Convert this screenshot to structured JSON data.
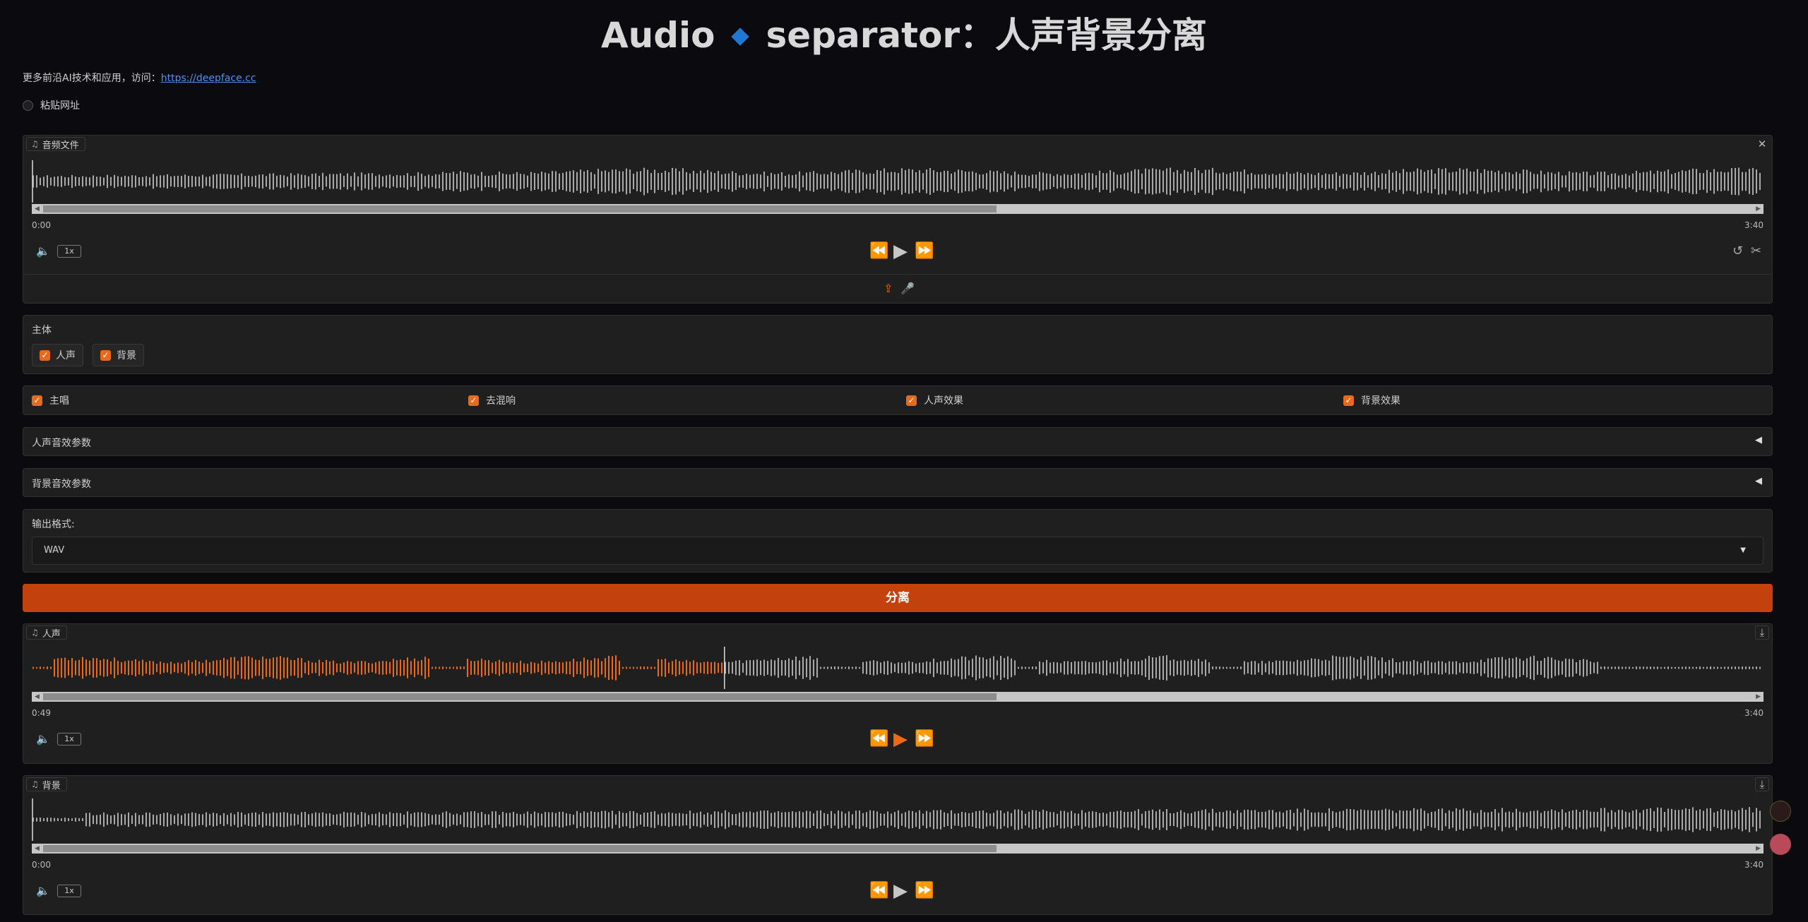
{
  "header": {
    "title_part1": "Audio",
    "title_part2": "separator：人声背景分离",
    "more_text": "更多前沿AI技术和应用，访问：",
    "more_link": "https://deepface.cc"
  },
  "paste": {
    "label": "粘贴网址",
    "checked": false
  },
  "input_audio": {
    "label": "音频文件",
    "time_start": "0:00",
    "time_end": "3:40",
    "rate": "1x"
  },
  "subject": {
    "label": "主体",
    "options": [
      {
        "label": "人声",
        "checked": true
      },
      {
        "label": "背景",
        "checked": true
      }
    ]
  },
  "options": [
    {
      "label": "主唱",
      "checked": true
    },
    {
      "label": "去混响",
      "checked": true
    },
    {
      "label": "人声效果",
      "checked": true
    },
    {
      "label": "背景效果",
      "checked": true
    }
  ],
  "accordions": [
    {
      "label": "人声音效参数",
      "open": false
    },
    {
      "label": "背景音效参数",
      "open": false
    }
  ],
  "format": {
    "label": "输出格式:",
    "value": "WAV"
  },
  "run_button": "分离",
  "vocals": {
    "label": "人声",
    "time_start": "0:49",
    "time_end": "3:40",
    "rate": "1x",
    "progress": 0.4
  },
  "background": {
    "label": "背景",
    "time_start": "0:00",
    "time_end": "3:40",
    "rate": "1x"
  },
  "colors": {
    "accent": "#ea6a1c",
    "button": "#c2410c",
    "background": "#0b0b0f",
    "panel": "#1f1f1f"
  }
}
